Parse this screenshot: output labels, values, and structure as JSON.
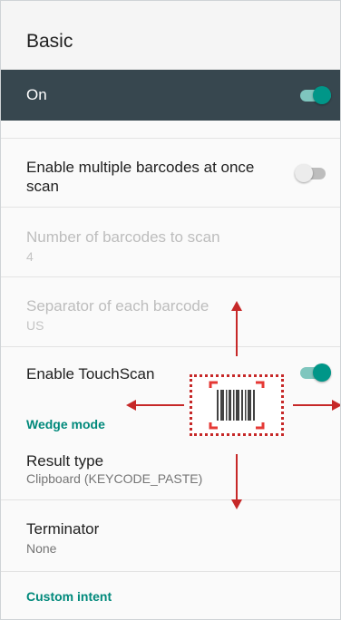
{
  "header": {
    "title": "Basic"
  },
  "master_switch": {
    "label": "On",
    "state": "on"
  },
  "settings": {
    "multi_barcode": {
      "label": "Enable multiple barcodes at once scan",
      "state": "off"
    },
    "num_barcodes": {
      "label": "Number of barcodes to scan",
      "value": "4"
    },
    "separator": {
      "label": "Separator of each barcode",
      "value": "US"
    },
    "touchscan": {
      "label": "Enable TouchScan",
      "state": "on"
    },
    "wedge_section": "Wedge mode",
    "result_type": {
      "label": "Result type",
      "value": "Clipboard (KEYCODE_PASTE)"
    },
    "terminator": {
      "label": "Terminator",
      "value": "None"
    },
    "intent_section": "Custom intent"
  },
  "icons": {
    "touchscan_overlay": "barcode-icon",
    "directions": [
      "arrow-up-icon",
      "arrow-down-icon",
      "arrow-left-icon",
      "arrow-right-icon"
    ]
  },
  "colors": {
    "toolbar_dark": "#37474f",
    "accent": "#009688",
    "overlay_red": "#c62828"
  }
}
